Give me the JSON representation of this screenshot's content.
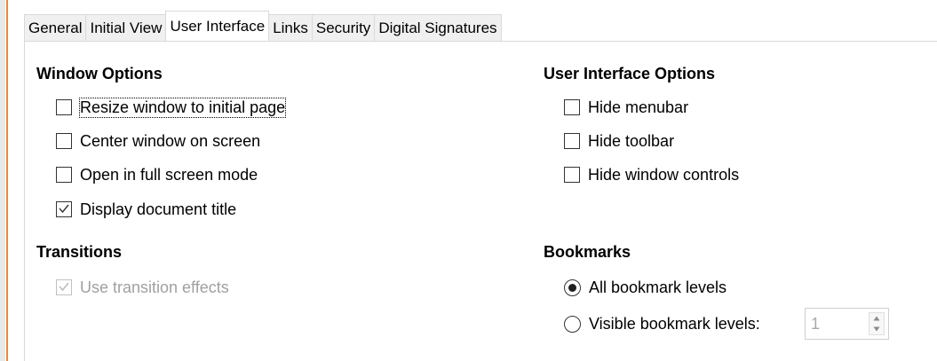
{
  "tabs": [
    {
      "label": "General",
      "active": false
    },
    {
      "label": "Initial View",
      "active": false
    },
    {
      "label": "User Interface",
      "active": true
    },
    {
      "label": "Links",
      "active": false
    },
    {
      "label": "Security",
      "active": false
    },
    {
      "label": "Digital Signatures",
      "active": false
    }
  ],
  "window_options": {
    "title": "Window Options",
    "items": [
      {
        "label": "Resize window to initial page",
        "checked": false
      },
      {
        "label": "Center window on screen",
        "checked": false
      },
      {
        "label": "Open in full screen mode",
        "checked": false
      },
      {
        "label": "Display document title",
        "checked": true
      }
    ]
  },
  "transitions": {
    "title": "Transitions",
    "items": [
      {
        "label": "Use transition effects",
        "checked": true,
        "disabled": true
      }
    ]
  },
  "ui_options": {
    "title": "User Interface Options",
    "items": [
      {
        "label": "Hide menubar",
        "checked": false
      },
      {
        "label": "Hide toolbar",
        "checked": false
      },
      {
        "label": "Hide window controls",
        "checked": false
      }
    ]
  },
  "bookmarks": {
    "title": "Bookmarks",
    "options": [
      {
        "label": "All bookmark levels",
        "selected": true
      },
      {
        "label": "Visible bookmark levels:",
        "selected": false
      }
    ],
    "levels_value": "1"
  },
  "colors": {
    "accent_orange": "#e58a3c",
    "disabled_text": "#a0a0a0"
  }
}
